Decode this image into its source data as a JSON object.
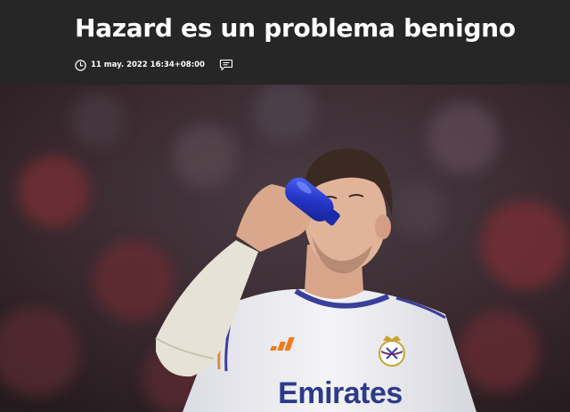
{
  "article": {
    "title": "Hazard es un problema benigno",
    "timestamp": "11 may. 2022 16:34+08:00"
  },
  "photo": {
    "sponsor_text": "Emirates"
  },
  "icons": {
    "clock": "clock-icon",
    "comment": "comment-icon",
    "club_crest": "club-crest-icon",
    "brand_logo": "adidas-logo-icon"
  },
  "colors": {
    "header_bg": "#262626",
    "title": "#ffffff",
    "jersey": "#f2f2f4",
    "jersey_trim": "#3a3f9a",
    "bottle": "#2c3fd6",
    "sponsor": "#2d3a8c",
    "brand_logo": "#f07a1a"
  }
}
